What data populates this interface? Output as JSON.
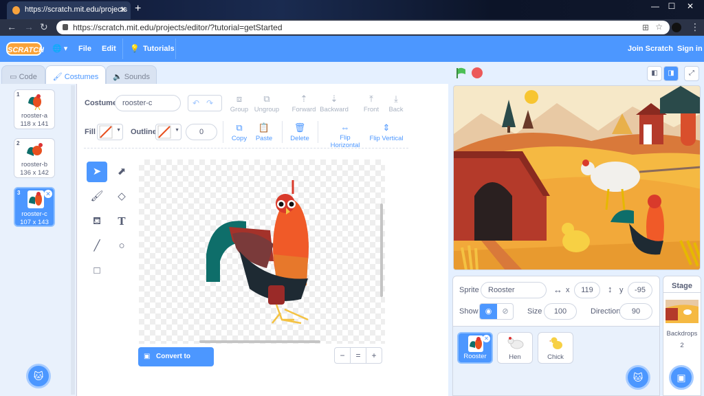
{
  "browser": {
    "tab_title": "https://scratch.mit.edu/projects",
    "url": "https://scratch.mit.edu/projects/editor/?tutorial=getStarted",
    "new_tab": "+",
    "tab_close": "✕",
    "back": "←",
    "forward": "→",
    "reload": "↻",
    "win_min": "—",
    "win_max": "☐",
    "win_close": "✕",
    "menu": "⋮"
  },
  "menubar": {
    "logo": "SCRATCH",
    "file": "File",
    "edit": "Edit",
    "tutorials": "Tutorials",
    "join": "Join Scratch",
    "signin": "Sign in",
    "globe": "🌐 ▾",
    "bulb": "💡"
  },
  "editor_tabs": {
    "code": "Code",
    "costumes": "Costumes",
    "sounds": "Sounds"
  },
  "costumes": [
    {
      "num": "1",
      "name": "rooster-a",
      "size": "118 x 141"
    },
    {
      "num": "2",
      "name": "rooster-b",
      "size": "136 x 142"
    },
    {
      "num": "3",
      "name": "rooster-c",
      "size": "107 x 143"
    }
  ],
  "paint": {
    "costume_label": "Costume",
    "costume_name": "rooster-c",
    "fill_label": "Fill",
    "outline_label": "Outline",
    "outline_width": "0",
    "group": "Group",
    "ungroup": "Ungroup",
    "forward": "Forward",
    "backward": "Backward",
    "front": "Front",
    "back": "Back",
    "copy": "Copy",
    "paste": "Paste",
    "delete": "Delete",
    "flip_h": "Flip Horizontal",
    "flip_v": "Flip Vertical",
    "convert": "Convert to Bitmap",
    "zoom_out": "−",
    "zoom_reset": "=",
    "zoom_in": "+"
  },
  "sprite_info": {
    "sprite_label": "Sprite",
    "sprite_name": "Rooster",
    "x_label": "x",
    "x": "119",
    "y_label": "y",
    "y": "-95",
    "show_label": "Show",
    "size_label": "Size",
    "size": "100",
    "direction_label": "Direction",
    "direction": "90"
  },
  "sprites": [
    {
      "name": "Rooster"
    },
    {
      "name": "Hen"
    },
    {
      "name": "Chick"
    }
  ],
  "stage_panel": {
    "title": "Stage",
    "backdrops_label": "Backdrops",
    "backdrops_count": "2"
  },
  "colors": {
    "accent": "#4c97ff",
    "menubar": "#4c97ff",
    "green_flag": "#4cbf56",
    "stop": "#ec5959"
  }
}
